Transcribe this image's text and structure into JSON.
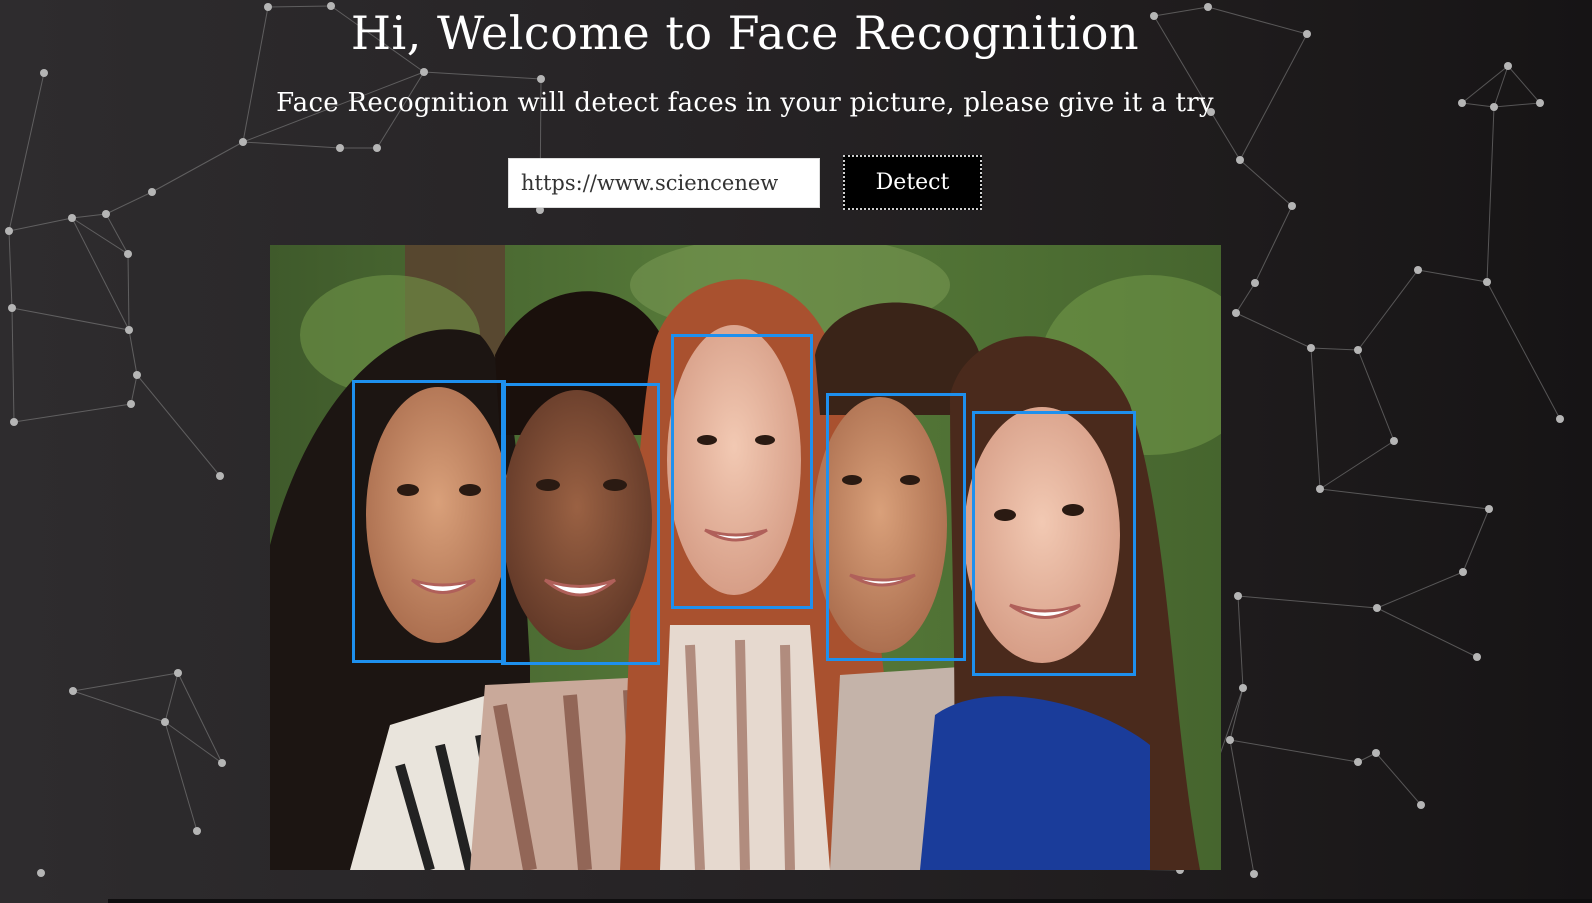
{
  "header": {
    "title": "Hi, Welcome to Face Recognition",
    "subtitle": "Face Recognition will detect faces in your picture, please give it a try"
  },
  "form": {
    "url_value": "https://www.sciencenew",
    "detect_label": "Detect"
  },
  "colors": {
    "face_box": "#1e90ee",
    "background": "#262325",
    "button": "#000000"
  },
  "detected_faces_count": 5
}
